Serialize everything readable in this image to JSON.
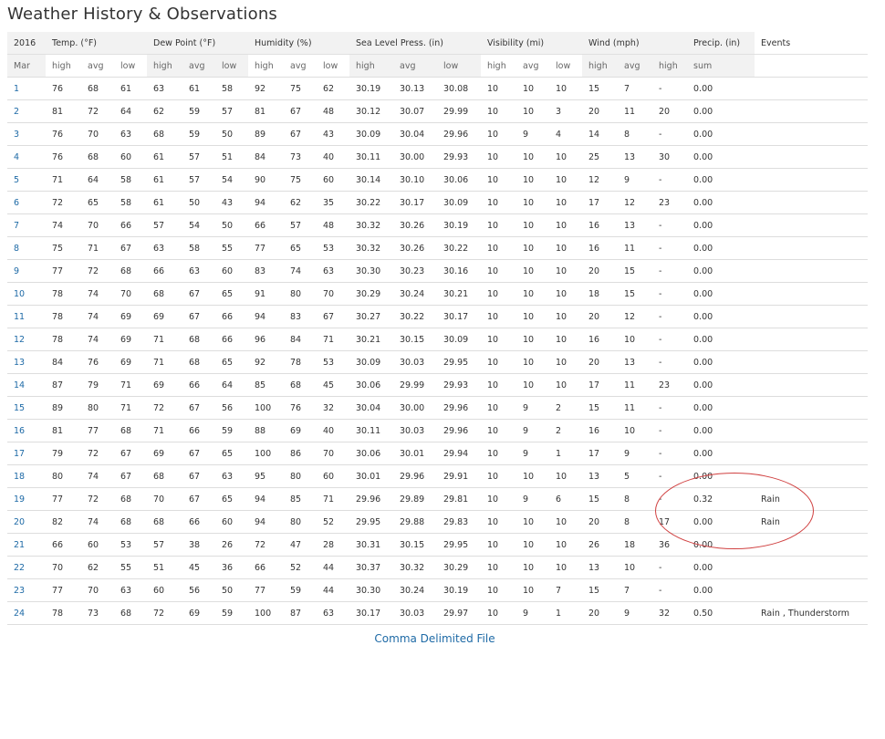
{
  "page": {
    "title": "Weather History & Observations",
    "csv_link": "Comma Delimited File"
  },
  "headers": {
    "year": "2016",
    "month": "Mar",
    "temp": "Temp. (°F)",
    "dew": "Dew Point (°F)",
    "humidity": "Humidity (%)",
    "pressure": "Sea Level Press. (in)",
    "visibility": "Visibility (mi)",
    "wind": "Wind (mph)",
    "precip": "Precip. (in)",
    "events": "Events",
    "sub": {
      "high": "high",
      "avg": "avg",
      "low": "low",
      "sum": "sum"
    }
  },
  "rows": [
    [
      "1",
      "76",
      "68",
      "61",
      "63",
      "61",
      "58",
      "92",
      "75",
      "62",
      "30.19",
      "30.13",
      "30.08",
      "10",
      "10",
      "10",
      "15",
      "7",
      "-",
      "0.00",
      ""
    ],
    [
      "2",
      "81",
      "72",
      "64",
      "62",
      "59",
      "57",
      "81",
      "67",
      "48",
      "30.12",
      "30.07",
      "29.99",
      "10",
      "10",
      "3",
      "20",
      "11",
      "20",
      "0.00",
      ""
    ],
    [
      "3",
      "76",
      "70",
      "63",
      "68",
      "59",
      "50",
      "89",
      "67",
      "43",
      "30.09",
      "30.04",
      "29.96",
      "10",
      "9",
      "4",
      "14",
      "8",
      "-",
      "0.00",
      ""
    ],
    [
      "4",
      "76",
      "68",
      "60",
      "61",
      "57",
      "51",
      "84",
      "73",
      "40",
      "30.11",
      "30.00",
      "29.93",
      "10",
      "10",
      "10",
      "25",
      "13",
      "30",
      "0.00",
      ""
    ],
    [
      "5",
      "71",
      "64",
      "58",
      "61",
      "57",
      "54",
      "90",
      "75",
      "60",
      "30.14",
      "30.10",
      "30.06",
      "10",
      "10",
      "10",
      "12",
      "9",
      "-",
      "0.00",
      ""
    ],
    [
      "6",
      "72",
      "65",
      "58",
      "61",
      "50",
      "43",
      "94",
      "62",
      "35",
      "30.22",
      "30.17",
      "30.09",
      "10",
      "10",
      "10",
      "17",
      "12",
      "23",
      "0.00",
      ""
    ],
    [
      "7",
      "74",
      "70",
      "66",
      "57",
      "54",
      "50",
      "66",
      "57",
      "48",
      "30.32",
      "30.26",
      "30.19",
      "10",
      "10",
      "10",
      "16",
      "13",
      "-",
      "0.00",
      ""
    ],
    [
      "8",
      "75",
      "71",
      "67",
      "63",
      "58",
      "55",
      "77",
      "65",
      "53",
      "30.32",
      "30.26",
      "30.22",
      "10",
      "10",
      "10",
      "16",
      "11",
      "-",
      "0.00",
      ""
    ],
    [
      "9",
      "77",
      "72",
      "68",
      "66",
      "63",
      "60",
      "83",
      "74",
      "63",
      "30.30",
      "30.23",
      "30.16",
      "10",
      "10",
      "10",
      "20",
      "15",
      "-",
      "0.00",
      ""
    ],
    [
      "10",
      "78",
      "74",
      "70",
      "68",
      "67",
      "65",
      "91",
      "80",
      "70",
      "30.29",
      "30.24",
      "30.21",
      "10",
      "10",
      "10",
      "18",
      "15",
      "-",
      "0.00",
      ""
    ],
    [
      "11",
      "78",
      "74",
      "69",
      "69",
      "67",
      "66",
      "94",
      "83",
      "67",
      "30.27",
      "30.22",
      "30.17",
      "10",
      "10",
      "10",
      "20",
      "12",
      "-",
      "0.00",
      ""
    ],
    [
      "12",
      "78",
      "74",
      "69",
      "71",
      "68",
      "66",
      "96",
      "84",
      "71",
      "30.21",
      "30.15",
      "30.09",
      "10",
      "10",
      "10",
      "16",
      "10",
      "-",
      "0.00",
      ""
    ],
    [
      "13",
      "84",
      "76",
      "69",
      "71",
      "68",
      "65",
      "92",
      "78",
      "53",
      "30.09",
      "30.03",
      "29.95",
      "10",
      "10",
      "10",
      "20",
      "13",
      "-",
      "0.00",
      ""
    ],
    [
      "14",
      "87",
      "79",
      "71",
      "69",
      "66",
      "64",
      "85",
      "68",
      "45",
      "30.06",
      "29.99",
      "29.93",
      "10",
      "10",
      "10",
      "17",
      "11",
      "23",
      "0.00",
      ""
    ],
    [
      "15",
      "89",
      "80",
      "71",
      "72",
      "67",
      "56",
      "100",
      "76",
      "32",
      "30.04",
      "30.00",
      "29.96",
      "10",
      "9",
      "2",
      "15",
      "11",
      "-",
      "0.00",
      ""
    ],
    [
      "16",
      "81",
      "77",
      "68",
      "71",
      "66",
      "59",
      "88",
      "69",
      "40",
      "30.11",
      "30.03",
      "29.96",
      "10",
      "9",
      "2",
      "16",
      "10",
      "-",
      "0.00",
      ""
    ],
    [
      "17",
      "79",
      "72",
      "67",
      "69",
      "67",
      "65",
      "100",
      "86",
      "70",
      "30.06",
      "30.01",
      "29.94",
      "10",
      "9",
      "1",
      "17",
      "9",
      "-",
      "0.00",
      ""
    ],
    [
      "18",
      "80",
      "74",
      "67",
      "68",
      "67",
      "63",
      "95",
      "80",
      "60",
      "30.01",
      "29.96",
      "29.91",
      "10",
      "10",
      "10",
      "13",
      "5",
      "-",
      "0.00",
      ""
    ],
    [
      "19",
      "77",
      "72",
      "68",
      "70",
      "67",
      "65",
      "94",
      "85",
      "71",
      "29.96",
      "29.89",
      "29.81",
      "10",
      "9",
      "6",
      "15",
      "8",
      "-",
      "0.32",
      "Rain"
    ],
    [
      "20",
      "82",
      "74",
      "68",
      "68",
      "66",
      "60",
      "94",
      "80",
      "52",
      "29.95",
      "29.88",
      "29.83",
      "10",
      "10",
      "10",
      "20",
      "8",
      "17",
      "0.00",
      "Rain"
    ],
    [
      "21",
      "66",
      "60",
      "53",
      "57",
      "38",
      "26",
      "72",
      "47",
      "28",
      "30.31",
      "30.15",
      "29.95",
      "10",
      "10",
      "10",
      "26",
      "18",
      "36",
      "0.00",
      ""
    ],
    [
      "22",
      "70",
      "62",
      "55",
      "51",
      "45",
      "36",
      "66",
      "52",
      "44",
      "30.37",
      "30.32",
      "30.29",
      "10",
      "10",
      "10",
      "13",
      "10",
      "-",
      "0.00",
      ""
    ],
    [
      "23",
      "77",
      "70",
      "63",
      "60",
      "56",
      "50",
      "77",
      "59",
      "44",
      "30.30",
      "30.24",
      "30.19",
      "10",
      "10",
      "7",
      "15",
      "7",
      "-",
      "0.00",
      ""
    ],
    [
      "24",
      "78",
      "73",
      "68",
      "72",
      "69",
      "59",
      "100",
      "87",
      "63",
      "30.17",
      "30.03",
      "29.97",
      "10",
      "9",
      "1",
      "20",
      "9",
      "32",
      "0.50",
      "Rain , Thunderstorm"
    ]
  ],
  "colors": {
    "link": "#1e6aa6",
    "header_bg": "#f2f2f2",
    "annotation": "#d04040"
  }
}
